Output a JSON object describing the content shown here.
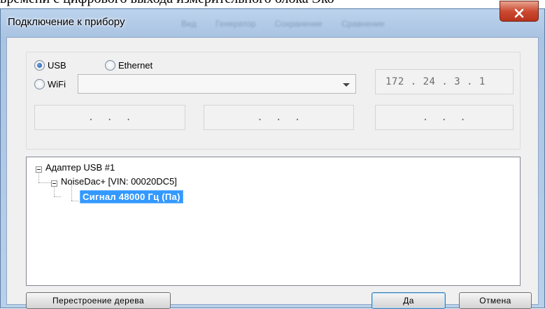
{
  "background_text": "времени с цифрового выхода измерительного блока Эко",
  "window": {
    "title": "Подключение к прибору",
    "ghost_menu": [
      "Вид",
      "Генератор",
      "Сохранение",
      "Сравнение"
    ]
  },
  "connection": {
    "usb_label": "USB",
    "ethernet_label": "Ethernet",
    "wifi_label": "WiFi",
    "selected": "USB",
    "wifi_network_value": "",
    "ip_main": "172 . 24 . 3 . 1",
    "ip_row": [
      " .  .  . ",
      " .  .  . ",
      " .  .  . "
    ]
  },
  "tree": {
    "root": "Адаптер USB #1",
    "device": "NoiseDac+ [VIN: 00020DC5]",
    "signal": "Сигнал 48000 Гц (Па)"
  },
  "buttons": {
    "rebuild": "Перестроение дерева",
    "ok": "Да",
    "cancel": "Отмена"
  },
  "colors": {
    "selection": "#3399ff",
    "close_button": "#cc4b32",
    "title_gradient": "#bcd3ec"
  }
}
